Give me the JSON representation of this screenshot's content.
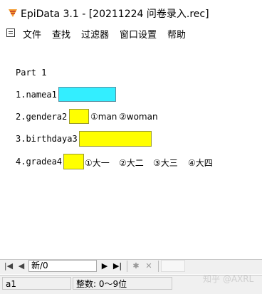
{
  "window": {
    "title": "EpiData 3.1 - [20211224 问卷录入.rec]"
  },
  "menu": {
    "items": [
      "文件",
      "查找",
      "过滤器",
      "窗口设置",
      "帮助"
    ]
  },
  "form": {
    "part": "Part 1",
    "q1": {
      "label": "1.namea1"
    },
    "q2": {
      "label": "2.gendera2",
      "options": [
        "①man",
        "②woman"
      ]
    },
    "q3": {
      "label": "3.birthdaya3"
    },
    "q4": {
      "label": "4.gradea4",
      "options": [
        "①大一",
        "②大二",
        "③大三",
        "④大四"
      ]
    }
  },
  "navigator": {
    "record": "新/0",
    "first": "|◀",
    "prev": "◀",
    "next": "▶",
    "last": "▶|",
    "new": "✱",
    "delete": "✕"
  },
  "status": {
    "field": "a1",
    "info": "整数: 0～9位"
  },
  "watermark": "知乎 @AXRL",
  "colors": {
    "focused_field": "#33eeff",
    "field": "#ffff00"
  }
}
